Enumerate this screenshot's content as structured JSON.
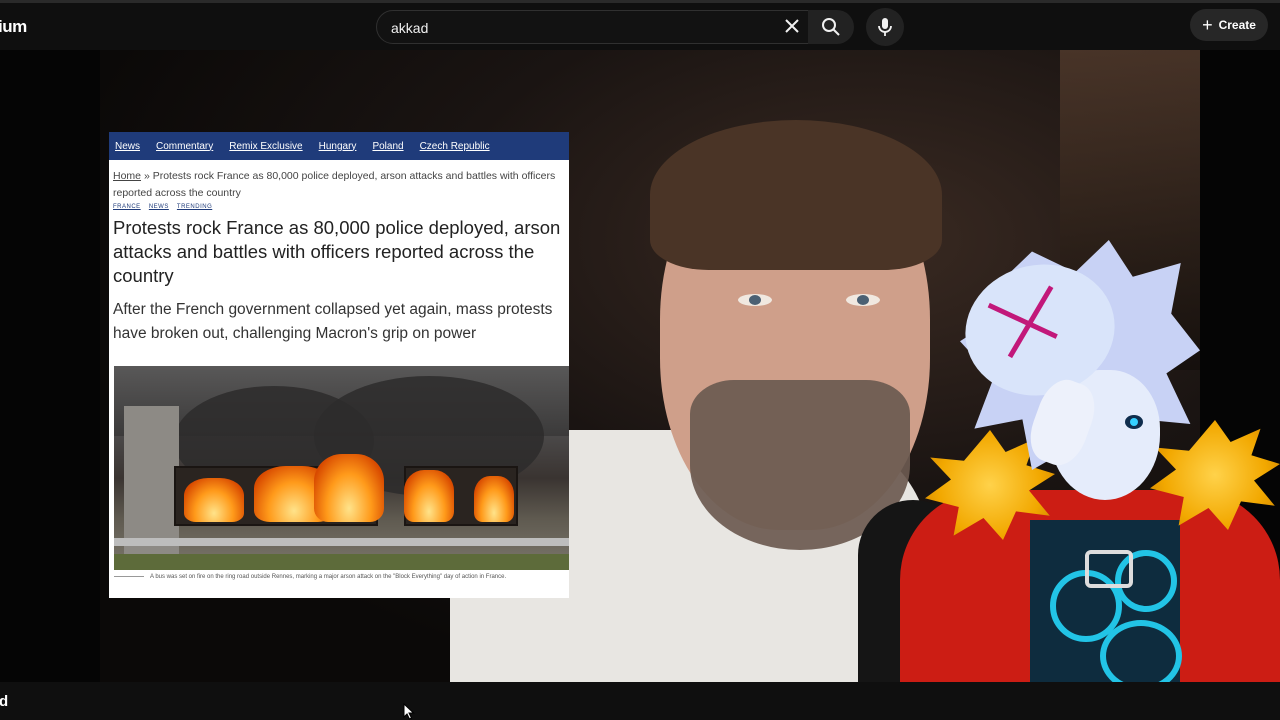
{
  "header": {
    "brand_fragment": "ium",
    "search": {
      "value": "akkad",
      "placeholder": ""
    },
    "create_label": "Create"
  },
  "icons": {
    "clear": "close-icon",
    "search": "search-icon",
    "mic": "microphone-icon",
    "create": "plus-icon",
    "cursor": "mouse-pointer-icon"
  },
  "article": {
    "nav": [
      "News",
      "Commentary",
      "Remix Exclusive",
      "Hungary",
      "Poland",
      "Czech Republic"
    ],
    "breadcrumb_home": "Home",
    "breadcrumb_rest": "» Protests rock France as 80,000 police deployed, arson attacks and battles with officers reported across the country",
    "tags": [
      "FRANCE",
      "NEWS",
      "TRENDING"
    ],
    "headline": "Protests rock France as 80,000 police deployed, arson attacks and battles with officers reported across the country",
    "subhead": "After the French government collapsed yet again, mass protests have broken out, challenging Macron's grip on power",
    "caption": "A bus was set on fire on the ring road outside Rennes, marking a major arson attack on the \"Block Everything\" day of action in France."
  },
  "footer": {
    "fragment": "d"
  },
  "colors": {
    "page_bg": "#0f0f0f",
    "article_nav": "#1f3b7a",
    "avatar_jacket": "#cc1d14",
    "avatar_collar": "#f2a800"
  }
}
